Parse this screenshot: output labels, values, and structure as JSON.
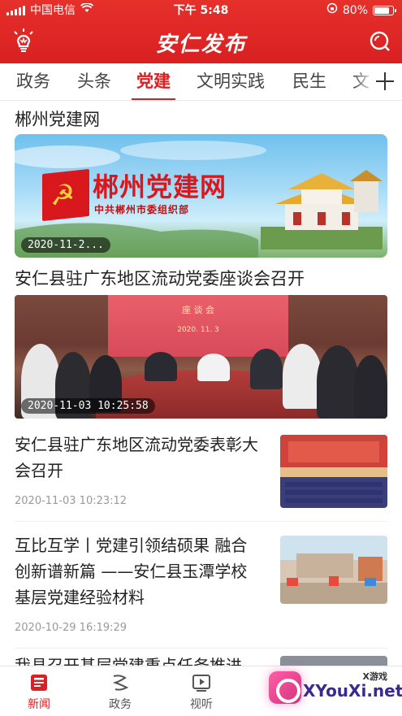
{
  "status_bar": {
    "carrier": "中国电信",
    "time": "下午 5:48",
    "battery": "80%",
    "battery_level": 0.8
  },
  "app": {
    "title": "安仁发布",
    "icons": [
      "bulb-icon",
      "search-icon"
    ]
  },
  "tabs": [
    {
      "label": "政务",
      "active": false
    },
    {
      "label": "头条",
      "active": false
    },
    {
      "label": "党建",
      "active": true
    },
    {
      "label": "文明实践",
      "active": false
    },
    {
      "label": "民生",
      "active": false
    },
    {
      "label": "文",
      "active": false
    }
  ],
  "feed": {
    "section_title": "郴州党建网",
    "banner": {
      "title": "郴州党建网",
      "subtitle": "中共郴州市委组织部",
      "time": "2020-11-2..."
    },
    "article1": {
      "title": "安仁县驻广东地区流动党委座谈会召开",
      "time": "2020-11-03 10:25:58",
      "screen_title": "座 谈 会",
      "screen_date": "2020. 11. 3"
    },
    "article2": {
      "title": "安仁县驻广东地区流动党委表彰大会召开",
      "time": "2020-11-03 10:23:12"
    },
    "article3": {
      "title": "互比互学丨党建引领结硕果 融合创新谱新篇 ——安仁县玉潭学校基层党建经验材料",
      "time": "2020-10-29 16:19:29"
    },
    "article4": {
      "title": "我县召开基层党建重点任务推进"
    }
  },
  "bottom_nav": [
    {
      "label": "新闻",
      "icon": "news-icon",
      "active": true
    },
    {
      "label": "政务",
      "icon": "gov-icon",
      "active": false
    },
    {
      "label": "视听",
      "icon": "video-icon",
      "active": false
    }
  ],
  "watermark": {
    "small": "X游戏",
    "text": "XYouXi.net"
  },
  "colors": {
    "brand_red": "#d92022",
    "text": "#222222",
    "muted": "#999999"
  }
}
